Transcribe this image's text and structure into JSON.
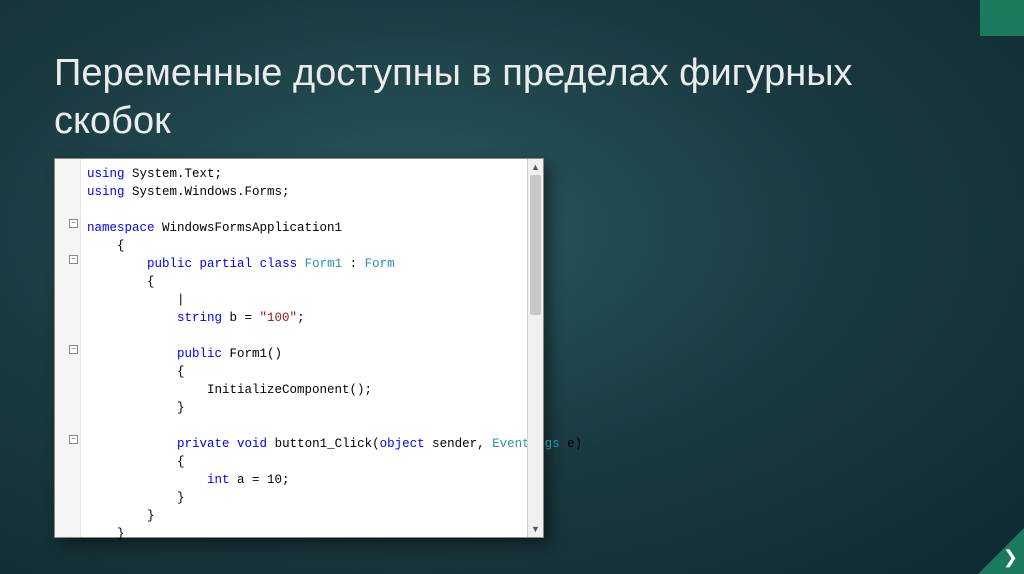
{
  "slide": {
    "title": "Переменные доступны в пределах фигурных скобок"
  },
  "code": {
    "lines": [
      {
        "indent": 0,
        "fold": null,
        "tokens": [
          [
            "kw",
            "using"
          ],
          [
            "",
            " System.Text;"
          ]
        ]
      },
      {
        "indent": 0,
        "fold": null,
        "tokens": [
          [
            "kw",
            "using"
          ],
          [
            "",
            " System.Windows.Forms;"
          ]
        ]
      },
      {
        "indent": 0,
        "fold": null,
        "tokens": []
      },
      {
        "indent": 0,
        "fold": "-",
        "tokens": [
          [
            "kw",
            "namespace"
          ],
          [
            "",
            " WindowsFormsApplication1"
          ]
        ]
      },
      {
        "indent": 1,
        "fold": null,
        "tokens": [
          [
            "",
            "{"
          ]
        ]
      },
      {
        "indent": 2,
        "fold": "-",
        "tokens": [
          [
            "kw",
            "public"
          ],
          [
            "",
            " "
          ],
          [
            "kw",
            "partial"
          ],
          [
            "",
            " "
          ],
          [
            "kw",
            "class"
          ],
          [
            "",
            " "
          ],
          [
            "type",
            "Form1"
          ],
          [
            "",
            " : "
          ],
          [
            "type",
            "Form"
          ]
        ]
      },
      {
        "indent": 2,
        "fold": null,
        "tokens": [
          [
            "",
            "{"
          ]
        ]
      },
      {
        "indent": 3,
        "fold": null,
        "tokens": [
          [
            "",
            "|"
          ]
        ]
      },
      {
        "indent": 3,
        "fold": null,
        "tokens": [
          [
            "kw",
            "string"
          ],
          [
            "",
            " b = "
          ],
          [
            "str",
            "\"100\""
          ],
          [
            "",
            ";"
          ]
        ]
      },
      {
        "indent": 2,
        "fold": null,
        "tokens": []
      },
      {
        "indent": 3,
        "fold": "-",
        "tokens": [
          [
            "kw",
            "public"
          ],
          [
            "",
            " Form1()"
          ]
        ]
      },
      {
        "indent": 3,
        "fold": null,
        "tokens": [
          [
            "",
            "{"
          ]
        ]
      },
      {
        "indent": 4,
        "fold": null,
        "tokens": [
          [
            "",
            "InitializeComponent();"
          ]
        ]
      },
      {
        "indent": 3,
        "fold": null,
        "tokens": [
          [
            "",
            "}"
          ]
        ]
      },
      {
        "indent": 2,
        "fold": null,
        "tokens": []
      },
      {
        "indent": 3,
        "fold": "-",
        "tokens": [
          [
            "kw",
            "private"
          ],
          [
            "",
            " "
          ],
          [
            "kw",
            "void"
          ],
          [
            "",
            " button1_Click("
          ],
          [
            "kw",
            "object"
          ],
          [
            "",
            " sender, "
          ],
          [
            "type",
            "EventArgs"
          ],
          [
            "",
            " e)"
          ]
        ]
      },
      {
        "indent": 3,
        "fold": null,
        "tokens": [
          [
            "",
            "{"
          ]
        ]
      },
      {
        "indent": 4,
        "fold": null,
        "tokens": [
          [
            "kw",
            "int"
          ],
          [
            "",
            " a = 10;"
          ]
        ]
      },
      {
        "indent": 3,
        "fold": null,
        "tokens": [
          [
            "",
            "}"
          ]
        ]
      },
      {
        "indent": 2,
        "fold": null,
        "tokens": [
          [
            "",
            "}"
          ]
        ]
      },
      {
        "indent": 1,
        "fold": null,
        "tokens": [
          [
            "",
            "}"
          ]
        ]
      }
    ]
  },
  "icons": {
    "fold_minus": "−",
    "scroll_up": "▲",
    "scroll_down": "▼",
    "chevron": "❯"
  }
}
